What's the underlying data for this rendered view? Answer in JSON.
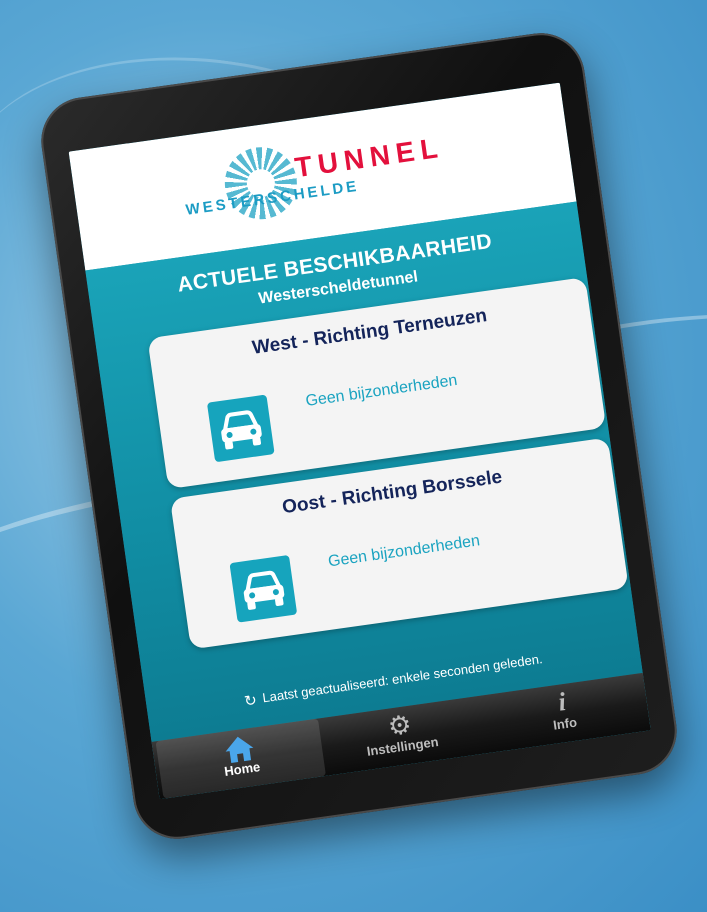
{
  "logo": {
    "tunnel": "TUNNEL",
    "westerschelde": "WESTERSCHELDE"
  },
  "header": {
    "title": "ACTUELE BESCHIKBAARHEID",
    "subtitle": "Westerscheldetunnel"
  },
  "directions": [
    {
      "title": "West - Richting Terneuzen",
      "status": "Geen bijzonderheden",
      "icon": "car-icon"
    },
    {
      "title": "Oost - Richting Borssele",
      "status": "Geen bijzonderheden",
      "icon": "car-icon"
    }
  ],
  "updated": {
    "text": "Laatst geactualiseerd: enkele seconden geleden.",
    "icon": "refresh-icon"
  },
  "tabs": [
    {
      "label": "Home",
      "icon": "home-icon",
      "active": true
    },
    {
      "label": "Instellingen",
      "icon": "gear-icon",
      "active": false
    },
    {
      "label": "Info",
      "icon": "info-icon",
      "active": false
    }
  ],
  "colors": {
    "accent": "#16a4bd",
    "logo_red": "#e3103c",
    "card_title": "#14245a"
  }
}
